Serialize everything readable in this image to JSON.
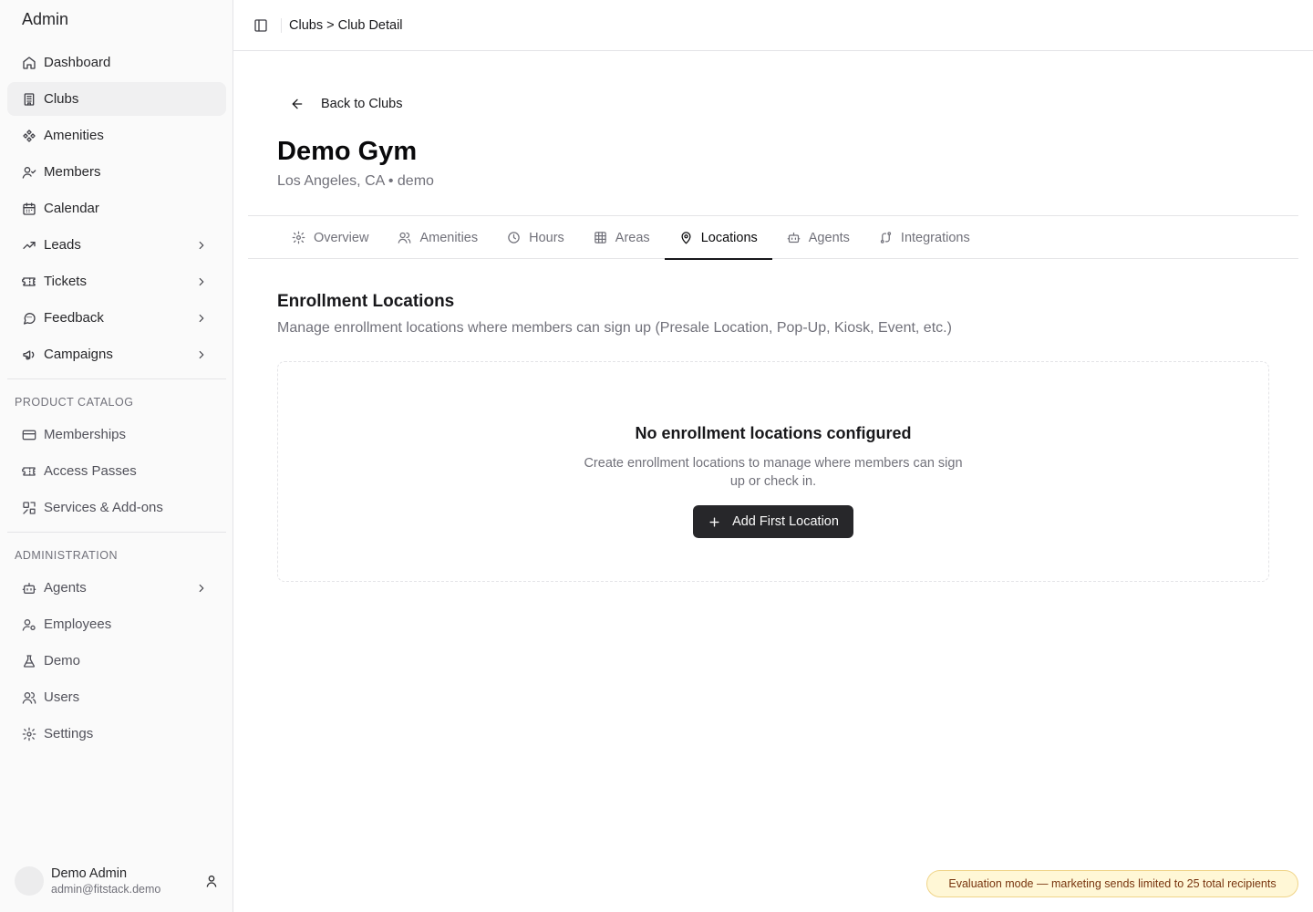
{
  "app": {
    "brand": "Admin"
  },
  "sidebar": {
    "main_items": [
      {
        "label": "Dashboard",
        "icon": "home-icon"
      },
      {
        "label": "Clubs",
        "icon": "building-icon",
        "active": true
      },
      {
        "label": "Amenities",
        "icon": "amenities-icon"
      },
      {
        "label": "Members",
        "icon": "user-check-icon"
      },
      {
        "label": "Calendar",
        "icon": "calendar-icon"
      },
      {
        "label": "Leads",
        "icon": "trending-up-icon",
        "expandable": true
      },
      {
        "label": "Tickets",
        "icon": "ticket-icon",
        "expandable": true
      },
      {
        "label": "Feedback",
        "icon": "message-icon",
        "expandable": true
      },
      {
        "label": "Campaigns",
        "icon": "megaphone-icon",
        "expandable": true
      }
    ],
    "product_catalog": {
      "label": "PRODUCT CATALOG",
      "items": [
        {
          "label": "Memberships",
          "icon": "credit-card-icon"
        },
        {
          "label": "Access Passes",
          "icon": "ticket-icon"
        },
        {
          "label": "Services & Add-ons",
          "icon": "services-icon"
        }
      ]
    },
    "administration": {
      "label": "ADMINISTRATION",
      "items": [
        {
          "label": "Agents",
          "icon": "bot-icon",
          "expandable": true
        },
        {
          "label": "Employees",
          "icon": "user-cog-icon"
        },
        {
          "label": "Demo",
          "icon": "flask-icon"
        },
        {
          "label": "Users",
          "icon": "users-icon"
        },
        {
          "label": "Settings",
          "icon": "gear-icon"
        }
      ]
    },
    "user": {
      "name": "Demo Admin",
      "email": "admin@fitstack.demo"
    }
  },
  "header": {
    "breadcrumb": "Clubs > Club Detail"
  },
  "page": {
    "back_label": "Back to Clubs",
    "title": "Demo Gym",
    "subtitle": "Los Angeles, CA • demo",
    "tabs": [
      {
        "label": "Overview",
        "icon": "gear-icon"
      },
      {
        "label": "Amenities",
        "icon": "users-icon"
      },
      {
        "label": "Hours",
        "icon": "clock-icon"
      },
      {
        "label": "Areas",
        "icon": "grid-icon"
      },
      {
        "label": "Locations",
        "icon": "map-pin-icon",
        "active": true
      },
      {
        "label": "Agents",
        "icon": "bot-icon"
      },
      {
        "label": "Integrations",
        "icon": "integrations-icon"
      }
    ],
    "section": {
      "title": "Enrollment Locations",
      "description": "Manage enrollment locations where members can sign up (Presale Location, Pop-Up, Kiosk, Event, etc.)"
    },
    "empty_state": {
      "title": "No enrollment locations configured",
      "description": "Create enrollment locations to manage where members can sign up or check in.",
      "button_label": "Add First Location"
    }
  },
  "toast": {
    "text": "Evaluation mode — marketing sends limited to 25 total recipients"
  },
  "colors": {
    "accent": "#27272a",
    "toast_bg": "#fff7d6",
    "toast_border": "#f0d58a",
    "toast_text": "#78350f"
  }
}
